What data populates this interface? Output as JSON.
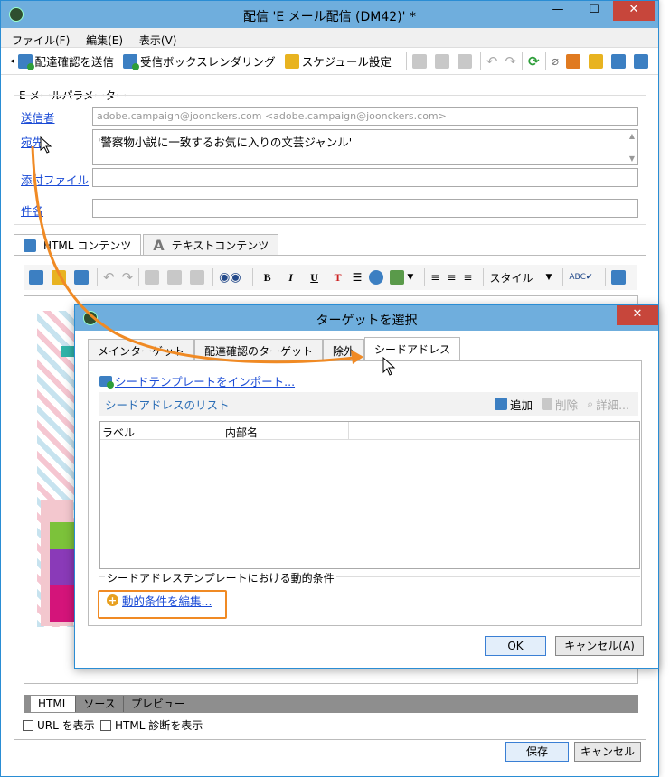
{
  "main_window": {
    "title": "配信 'E メール配信 (DM42)' *",
    "menu": [
      "ファイル(F)",
      "編集(E)",
      "表示(V)"
    ],
    "toolbar": {
      "send_proof": "配達確認を送信",
      "inbox_render": "受信ボックスレンダリング",
      "schedule": "スケジュール設定"
    },
    "email_params": {
      "legend": "E メールパラメーター",
      "from_label": "送信者",
      "from_value": "adobe.campaign@joonckers.com <adobe.campaign@joonckers.com>",
      "to_label": "宛先",
      "to_value": "'警察物小説に一致するお気に入りの文芸ジャンル'",
      "attach_label": "添付ファイル",
      "subject_label": "件名"
    },
    "content_tabs": [
      "HTML コンテンツ",
      "テキストコンテンツ"
    ],
    "editor": {
      "style_label": "スタイル",
      "bottom_tabs": [
        "HTML",
        "ソース",
        "プレビュー"
      ]
    },
    "checkboxes": [
      "URL を表示",
      "HTML 診断を表示"
    ],
    "buttons": {
      "save": "保存",
      "cancel": "キャンセル"
    }
  },
  "dialog": {
    "title": "ターゲットを選択",
    "tabs": [
      "メインターゲット",
      "配達確認のターゲット",
      "除外",
      "シードアドレス"
    ],
    "import_link": "シードテンプレートをインポート...",
    "list_title": "シードアドレスのリスト",
    "list_actions": {
      "add": "追加",
      "delete": "削除",
      "details": "詳細..."
    },
    "columns": [
      "ラベル",
      "内部名"
    ],
    "dynamic_section": "シードアドレステンプレートにおける動的条件",
    "edit_link": "動的条件を編集...",
    "buttons": {
      "ok": "OK",
      "cancel": "キャンセル(A)"
    }
  },
  "colors": {
    "accent_orange": "#f08a24",
    "titlebar": "#6faedd",
    "close": "#c7463b",
    "link": "#1a4bd6"
  }
}
